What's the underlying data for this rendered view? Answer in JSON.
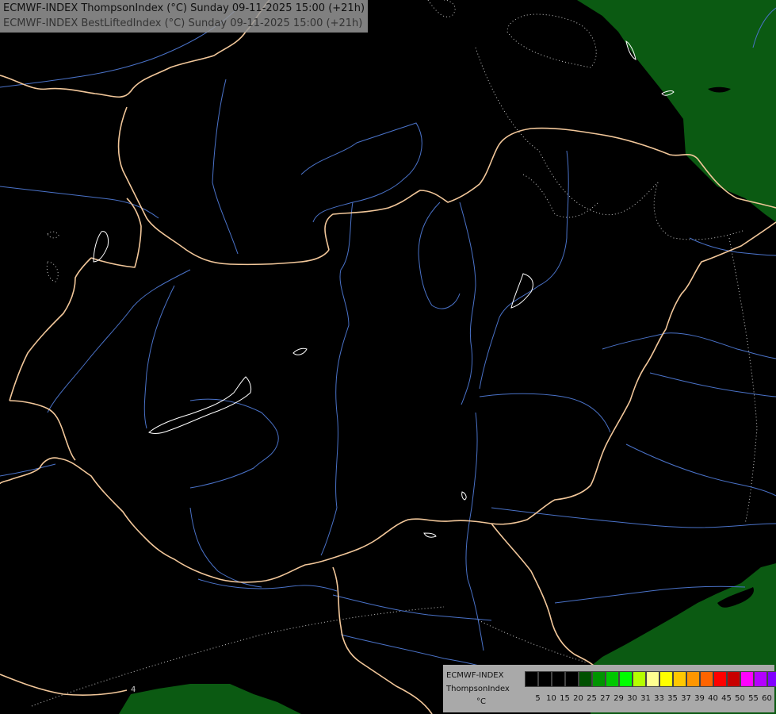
{
  "title": {
    "line1": "ECMWF-INDEX ThompsonIndex (°C) Sunday 09-11-2025 15:00 (+21h)",
    "line2": "ECMWF-INDEX BestLiftedIndex (°C) Sunday 09-11-2025 15:00 (+21h)"
  },
  "legend": {
    "model": "ECMWF-INDEX",
    "parameter": "ThompsonIndex",
    "unit": "°C",
    "colors": [
      "#000000",
      "#000000",
      "#000000",
      "#000000",
      "#005000",
      "#009400",
      "#00c800",
      "#00ff00",
      "#b4ff00",
      "#ffff90",
      "#ffff00",
      "#ffc800",
      "#ff9600",
      "#ff6400",
      "#ff0000",
      "#c80000",
      "#ff00ff",
      "#b400ff",
      "#8000ff",
      "#5000ff",
      "#0000ff"
    ],
    "ticks": [
      "5",
      "10",
      "15",
      "20",
      "25",
      "27",
      "29",
      "30",
      "31",
      "33",
      "35",
      "37",
      "39",
      "40",
      "45",
      "50",
      "55",
      "60"
    ]
  },
  "map_colors": {
    "background": "#000000",
    "fill_region": "#0b5a12",
    "border": "#f2c79a",
    "river": "#4a72c8",
    "contour": "#c8c8c8",
    "lake_outline": "#ffffff"
  },
  "map_labels": {
    "contour_label": "4"
  }
}
